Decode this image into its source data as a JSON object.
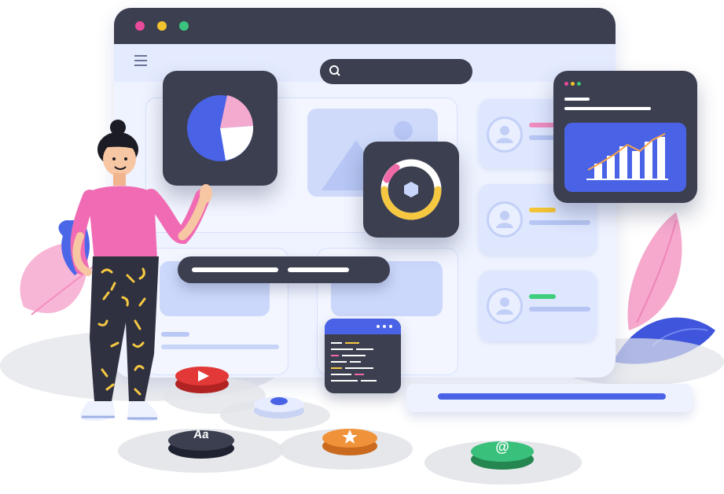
{
  "window": {
    "traffic_lights": [
      "#e94a9a",
      "#f2c230",
      "#3bc27d"
    ]
  },
  "icons": {
    "menu": "menu-icon",
    "search": "search-icon",
    "play": "play-icon",
    "star": "star-icon",
    "at": "at-sign-icon",
    "user": "user-icon"
  },
  "buttons": {
    "text_button_label": "Aa",
    "at_button_label": "@"
  },
  "colors": {
    "accent_blue": "#4a63e6",
    "dark_tile": "#3b3f4f",
    "pink": "#f4a9cf",
    "yellow": "#f6c842",
    "green": "#39c07b",
    "orange": "#f0923a",
    "red": "#e23838"
  }
}
